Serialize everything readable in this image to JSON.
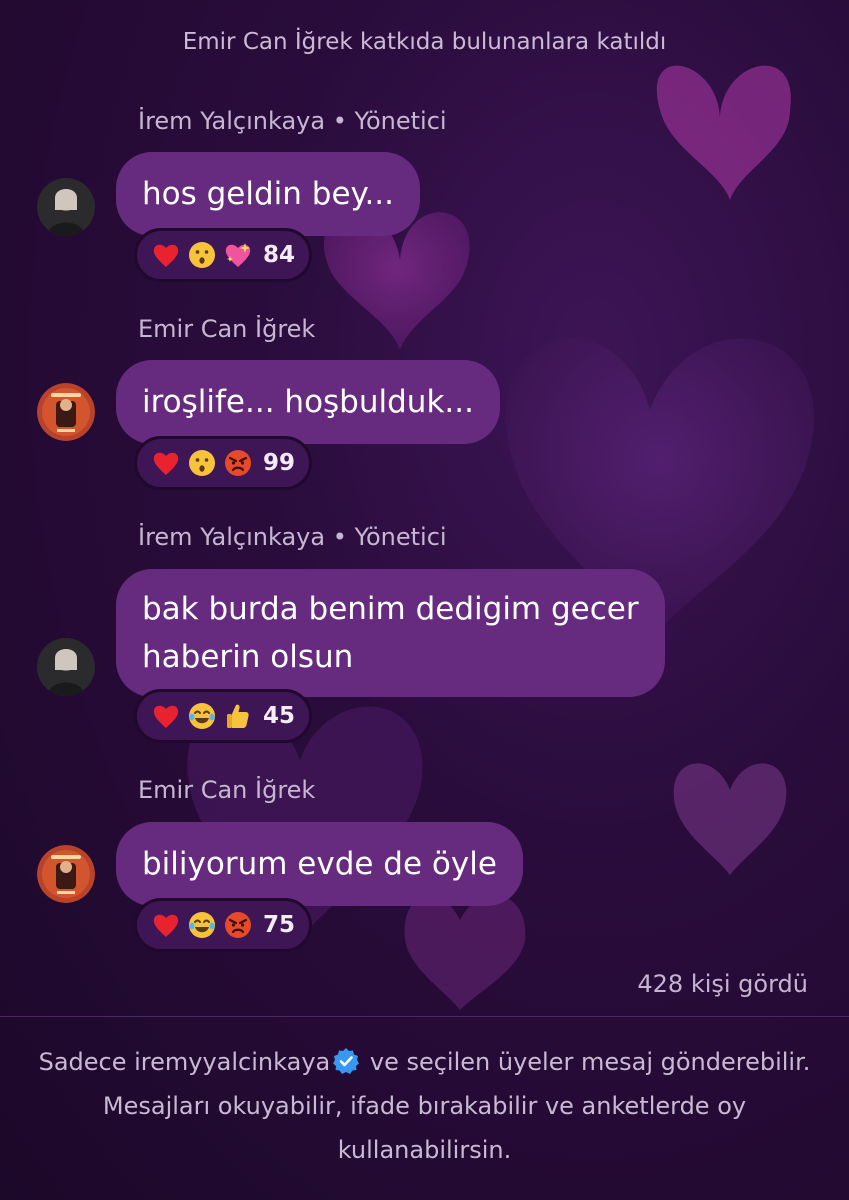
{
  "system_message": "Emir Can İğrek katkıda bulunanlara katıldı",
  "messages": [
    {
      "sender": "İrem Yalçınkaya • Yönetici",
      "text_lines": [
        "hos geldin bey..."
      ],
      "reactions": [
        "red-heart",
        "hushed-face",
        "sparkling-heart"
      ],
      "count": "84"
    },
    {
      "sender": "Emir Can İğrek",
      "text_lines": [
        "iroşlife... hoşbulduk..."
      ],
      "reactions": [
        "red-heart",
        "hushed-face",
        "angry-face"
      ],
      "count": "99"
    },
    {
      "sender": "İrem Yalçınkaya • Yönetici",
      "text_lines": [
        "bak burda benim dedigim gecer",
        "haberin olsun"
      ],
      "reactions": [
        "red-heart",
        "tears-of-joy-face",
        "thumbs-up"
      ],
      "count": "45"
    },
    {
      "sender": "Emir Can İğrek",
      "text_lines": [
        "biliyorum evde de öyle"
      ],
      "reactions": [
        "red-heart",
        "tears-of-joy-face",
        "angry-face"
      ],
      "count": "75"
    }
  ],
  "seen_count": "428 kişi gördü",
  "footer": {
    "line1_before": "Sadece iremyyalcinkaya",
    "line1_after": " ve seçilen üyeler mesaj gönderebilir.",
    "line2": "Mesajları okuyabilir, ifade bırakabilir ve anketlerde oy",
    "line3": "kullanabilirsin."
  },
  "colors": {
    "bubble": "#662b7f",
    "background": "#2a0c3c",
    "verified": "#3897f0"
  }
}
